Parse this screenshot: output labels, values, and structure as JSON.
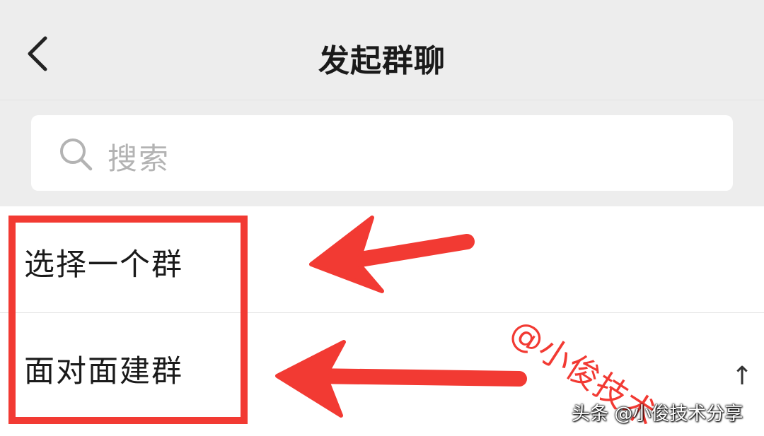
{
  "header": {
    "title": "发起群聊",
    "back_icon": "chevron-left-icon"
  },
  "search": {
    "placeholder": "搜索",
    "icon": "search-icon"
  },
  "list": {
    "items": [
      {
        "label": "选择一个群"
      },
      {
        "label": "面对面建群"
      }
    ]
  },
  "annotations": {
    "watermark": "@小俊技术",
    "color": "#f23a33"
  },
  "scroll": {
    "arrow": "↑"
  },
  "footer": {
    "source": "头条 @小俊技术分享"
  },
  "colors": {
    "header_bg": "#ededed",
    "accent_red": "#f23a33",
    "placeholder": "#b3b3b3"
  }
}
